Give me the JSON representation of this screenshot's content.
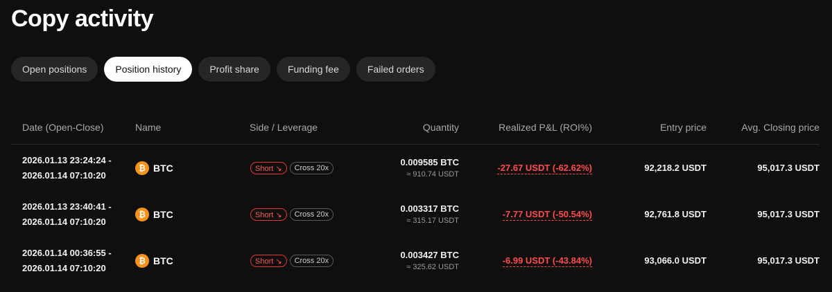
{
  "page_title": "Copy activity",
  "tabs": [
    {
      "label": "Open positions",
      "active": false
    },
    {
      "label": "Position history",
      "active": true
    },
    {
      "label": "Profit share",
      "active": false
    },
    {
      "label": "Funding fee",
      "active": false
    },
    {
      "label": "Failed orders",
      "active": false
    }
  ],
  "table": {
    "columns": [
      "Date (Open-Close)",
      "Name",
      "Side / Leverage",
      "Quantity",
      "Realized P&L (ROI%)",
      "Entry price",
      "Avg. Closing price"
    ],
    "rows": [
      {
        "open": "2026.01.13 23:24:24 -",
        "close": "2026.01.14 07:10:20",
        "coin_icon": "bitcoin-icon",
        "coin_glyph": "₿",
        "name": "BTC",
        "side": "Short ↘",
        "leverage": "Cross 20x",
        "qty": "0.009585 BTC",
        "qty_usdt": "≈ 910.74 USDT",
        "pnl": "-27.67 USDT (-62.62%)",
        "entry": "92,218.2 USDT",
        "avg_close": "95,017.3 USDT"
      },
      {
        "open": "2026.01.13 23:40:41 -",
        "close": "2026.01.14 07:10:20",
        "coin_icon": "bitcoin-icon",
        "coin_glyph": "₿",
        "name": "BTC",
        "side": "Short ↘",
        "leverage": "Cross 20x",
        "qty": "0.003317 BTC",
        "qty_usdt": "≈ 315.17 USDT",
        "pnl": "-7.77 USDT (-50.54%)",
        "entry": "92,761.8 USDT",
        "avg_close": "95,017.3 USDT"
      },
      {
        "open": "2026.01.14 00:36:55 -",
        "close": "2026.01.14 07:10:20",
        "coin_icon": "bitcoin-icon",
        "coin_glyph": "₿",
        "name": "BTC",
        "side": "Short ↘",
        "leverage": "Cross 20x",
        "qty": "0.003427 BTC",
        "qty_usdt": "≈ 325.62 USDT",
        "pnl": "-6.99 USDT (-43.84%)",
        "entry": "93,066.0 USDT",
        "avg_close": "95,017.3 USDT"
      }
    ]
  },
  "colors": {
    "background": "#0f0f0f",
    "active_tab": "#ffffff",
    "loss": "#ff4d4d",
    "btc": "#f7931a"
  }
}
